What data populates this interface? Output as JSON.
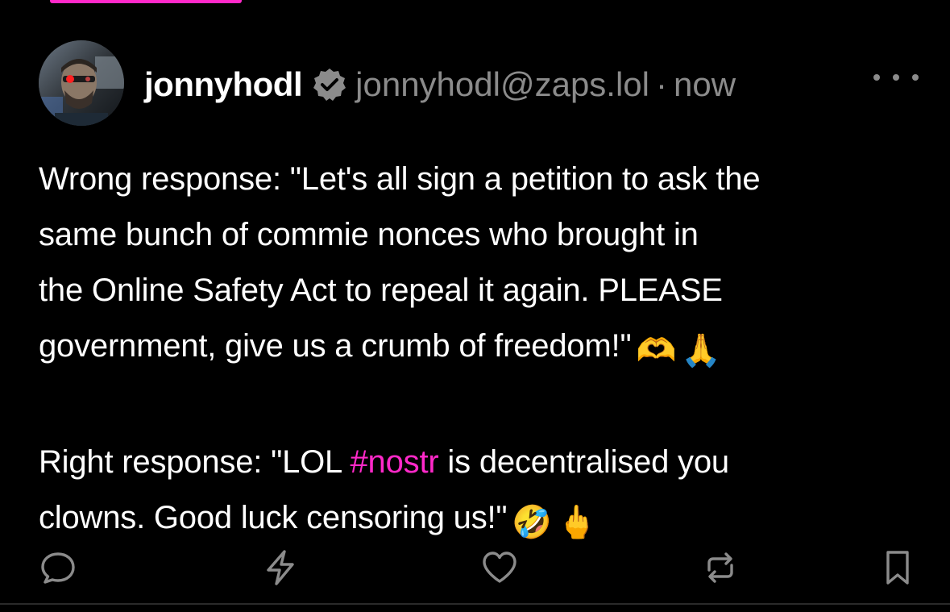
{
  "colors": {
    "background": "#000000",
    "text": "#ffffff",
    "muted": "#8b8b8b",
    "accent": "#ff29c9",
    "icon": "#8b8b8b"
  },
  "author": {
    "display_name": "jonnyhodl",
    "handle": "jonnyhodl@zaps.lol",
    "separator": "·",
    "timestamp": "now",
    "verified_icon": "verified-badge-icon"
  },
  "post": {
    "wrong_lines": [
      "Wrong response: \"Let's all sign a petition to ask the",
      "same bunch of commie nonces who brought in",
      "the Online Safety Act to repeal it again. PLEASE",
      "government, give us a crumb of freedom!\""
    ],
    "wrong_emojis": [
      "🫶",
      "🙏"
    ],
    "right_line1_prefix": "Right response: \"LOL ",
    "hashtag": "#nostr",
    "right_line1_suffix": " is decentralised you",
    "right_line2": "clowns. Good luck censoring us!\"",
    "right_emojis": [
      "🤣",
      "🖕"
    ]
  },
  "actions": [
    {
      "name": "reply-icon"
    },
    {
      "name": "zap-icon"
    },
    {
      "name": "like-icon"
    },
    {
      "name": "repost-icon"
    },
    {
      "name": "bookmark-icon"
    }
  ]
}
